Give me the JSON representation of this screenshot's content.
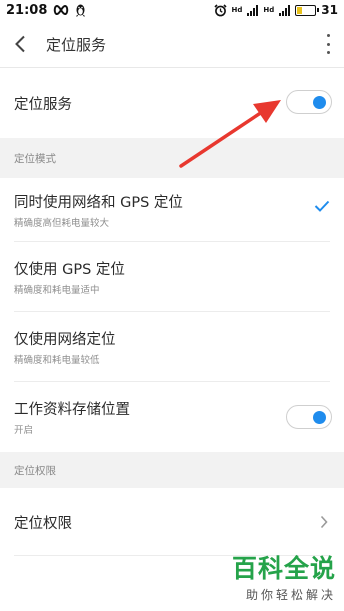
{
  "status_bar": {
    "time": "21:08",
    "sim1_label": "Hd",
    "sim2_label": "Hd",
    "battery_level": "31",
    "battery_fraction": 0.31
  },
  "header": {
    "title": "定位服务"
  },
  "location_service": {
    "label": "定位服务",
    "enabled": true
  },
  "mode_section": {
    "header": "定位模式",
    "options": [
      {
        "title": "同时使用网络和 GPS 定位",
        "subtitle": "精确度高但耗电量较大",
        "selected": true
      },
      {
        "title": "仅使用 GPS 定位",
        "subtitle": "精确度和耗电量适中",
        "selected": false
      },
      {
        "title": "仅使用网络定位",
        "subtitle": "精确度和耗电量较低",
        "selected": false
      }
    ],
    "work_storage": {
      "title": "工作资料存储位置",
      "subtitle": "开启",
      "enabled": true
    }
  },
  "permission_section": {
    "header": "定位权限",
    "item": "定位权限"
  },
  "watermark": {
    "main": "百科全说",
    "sub": "助你轻松解决"
  },
  "colors": {
    "accent": "#1f8ced",
    "annotation_arrow": "#e8382f",
    "watermark_green": "#25a34a"
  }
}
